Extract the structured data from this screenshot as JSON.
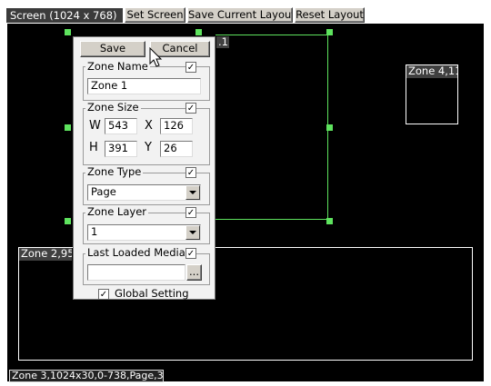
{
  "toolbar": {
    "screen_label": "Screen (1024 x 768)",
    "set_screen": "Set Screen",
    "save_layout": "Save Current Layout",
    "reset_layout": "Reset Layout"
  },
  "zones": {
    "zone1_tab": ".1",
    "zone2_label": "Zone 2,95",
    "zone4_label": "Zone 4,11",
    "status_text": "Zone 3,1024x30,0-738,Page,3"
  },
  "panel": {
    "save": "Save",
    "cancel": "Cancel",
    "zone_name": {
      "legend": "Zone Name",
      "checked": true,
      "value": "Zone 1"
    },
    "zone_size": {
      "legend": "Zone Size",
      "checked": true,
      "w_label": "W",
      "w": "543",
      "x_label": "X",
      "x": "126",
      "h_label": "H",
      "h": "391",
      "y_label": "Y",
      "y": "26"
    },
    "zone_type": {
      "legend": "Zone Type",
      "checked": true,
      "value": "Page"
    },
    "zone_layer": {
      "legend": "Zone Layer",
      "checked": true,
      "value": "1"
    },
    "last_loaded_media": {
      "legend": "Last Loaded Media",
      "checked": true,
      "value": "",
      "browse": "..."
    },
    "global_setting": {
      "label": "Global Setting",
      "checked": true
    }
  },
  "colors": {
    "canvas": "#000000",
    "selection": "#5ee35e",
    "panel": "#f2f2f2"
  }
}
